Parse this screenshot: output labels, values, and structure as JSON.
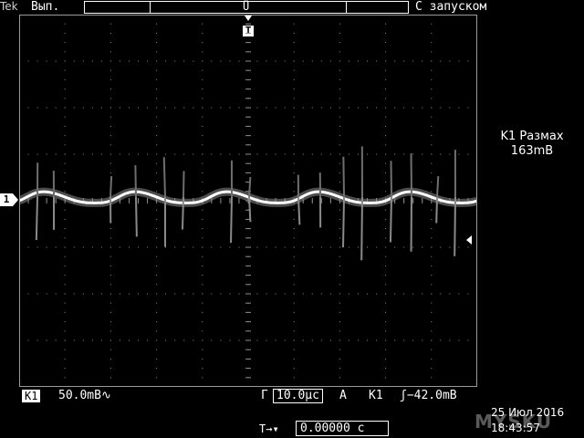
{
  "header": {
    "brand": "Tek",
    "acquisition_state": "Вып.",
    "trigger_position_marker": "T",
    "trigger_mode": "С запуском"
  },
  "channel": {
    "marker": "1",
    "tag": "K1",
    "volts_per_div": "50.0mB∿"
  },
  "measurement": {
    "label": "K1 Размах",
    "value": "163mB"
  },
  "timebase": {
    "label": "Г",
    "value": "10.0µc"
  },
  "trigger": {
    "label": "A",
    "source": "K1",
    "level": "ʃ−42.0mB"
  },
  "horizontal_position": {
    "icon": "T→▾",
    "value": "0.00000 c"
  },
  "datetime": {
    "date": "25 Июл 2016",
    "time": "18:43:57"
  },
  "watermark": "MYSKU",
  "colors": {
    "background": "#000000",
    "graticule": "#8c8c8c",
    "trace": "#ffffff"
  },
  "waveform": {
    "cycles_on_screen": 5,
    "noise_visible": true
  }
}
